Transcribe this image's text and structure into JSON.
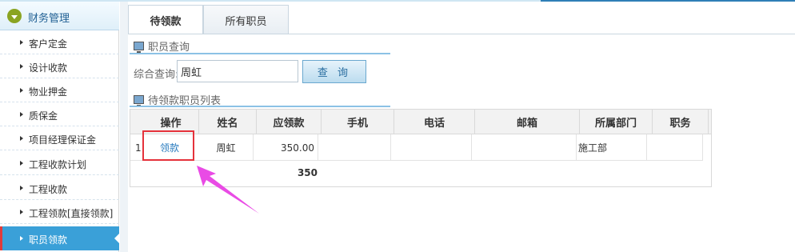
{
  "sidebar": {
    "header": "财务管理",
    "items": [
      {
        "label": "客户定金",
        "active": false
      },
      {
        "label": "设计收款",
        "active": false
      },
      {
        "label": "物业押金",
        "active": false
      },
      {
        "label": "质保金",
        "active": false
      },
      {
        "label": "项目经理保证金",
        "active": false
      },
      {
        "label": "工程收款计划",
        "active": false
      },
      {
        "label": "工程收款",
        "active": false
      },
      {
        "label": "工程领款[直接领款]",
        "active": false
      },
      {
        "label": "职员领款",
        "active": true
      }
    ]
  },
  "tabs": [
    {
      "label": "待领款",
      "active": true
    },
    {
      "label": "所有职员",
      "active": false
    }
  ],
  "query_section": {
    "title": "职员查询",
    "label": "综合查询:",
    "value": "周虹",
    "button": "查 询"
  },
  "list_section": {
    "title": "待领款职员列表"
  },
  "table": {
    "columns": [
      "操作",
      "姓名",
      "应领款",
      "手机",
      "电话",
      "邮箱",
      "所属部门",
      "职务"
    ],
    "rows": [
      {
        "index": "1",
        "action": "领款",
        "name": "周虹",
        "amount": "350.00",
        "mobile": "",
        "phone": "",
        "email": "",
        "department": "施工部",
        "position": ""
      }
    ],
    "total": "350"
  },
  "colors": {
    "accent": "#3aa0d8",
    "highlight_box": "#e5323b",
    "arrow": "#e94be5"
  }
}
